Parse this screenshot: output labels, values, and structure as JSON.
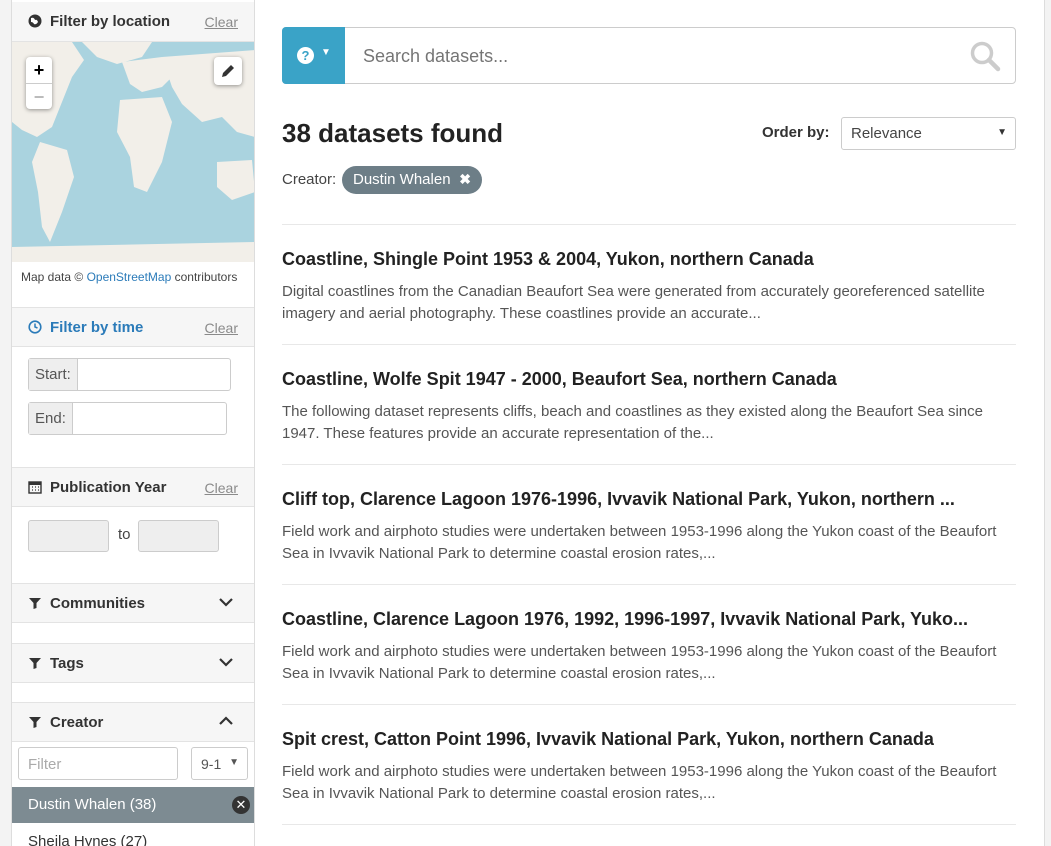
{
  "sidebar": {
    "location": {
      "title": "Filter by location",
      "clear": "Clear"
    },
    "map": {
      "zoom_in": "+",
      "zoom_out": "−",
      "attribution_prefix": "Map data ©",
      "attribution_link": "OpenStreetMap",
      "attribution_suffix": "contributors"
    },
    "time": {
      "title": "Filter by time",
      "clear": "Clear",
      "start_label": "Start:",
      "end_label": "End:"
    },
    "pubyear": {
      "title": "Publication Year",
      "clear": "Clear",
      "to": "to"
    },
    "communities": {
      "title": "Communities"
    },
    "tags": {
      "title": "Tags"
    },
    "creator": {
      "title": "Creator",
      "filter_placeholder": "Filter",
      "sort_value": "9-1",
      "active_item": "Dustin Whalen (38)",
      "items": [
        "Sheila Hynes (27)"
      ]
    }
  },
  "search": {
    "placeholder": "Search datasets...",
    "help": "?"
  },
  "results_header": {
    "count_text": "38 datasets found",
    "order_label": "Order by:",
    "order_value": "Relevance",
    "filter_label": "Creator:",
    "filter_pill": "Dustin Whalen"
  },
  "results": [
    {
      "title": "Coastline, Shingle Point 1953 & 2004, Yukon, northern Canada",
      "description": "Digital coastlines from the Canadian Beaufort Sea were generated from accurately georeferenced satellite imagery and aerial photography. These coastlines provide an accurate..."
    },
    {
      "title": "Coastline, Wolfe Spit 1947 - 2000, Beaufort Sea, northern Canada",
      "description": "The following dataset represents cliffs, beach and coastlines as they existed along the Beaufort Sea since 1947. These features provide an accurate representation of the..."
    },
    {
      "title": "Cliff top, Clarence Lagoon 1976-1996, Ivvavik National Park, Yukon, northern ...",
      "description": "Field work and airphoto studies were undertaken between 1953-1996 along the Yukon coast of the Beaufort Sea in Ivvavik National Park to determine coastal erosion rates,..."
    },
    {
      "title": "Coastline, Clarence Lagoon 1976, 1992, 1996-1997, Ivvavik National Park, Yuko...",
      "description": "Field work and airphoto studies were undertaken between 1953-1996 along the Yukon coast of the Beaufort Sea in Ivvavik National Park to determine coastal erosion rates,..."
    },
    {
      "title": "Spit crest, Catton Point 1996, Ivvavik National Park, Yukon, northern Canada",
      "description": "Field work and airphoto studies were undertaken between 1953-1996 along the Yukon coast of the Beaufort Sea in Ivvavik National Park to determine coastal erosion rates,..."
    }
  ],
  "colors": {
    "accent": "#3aa3c7",
    "pill": "#6d7e87",
    "active_row": "#7d8b92",
    "link": "#2b7bb9"
  }
}
